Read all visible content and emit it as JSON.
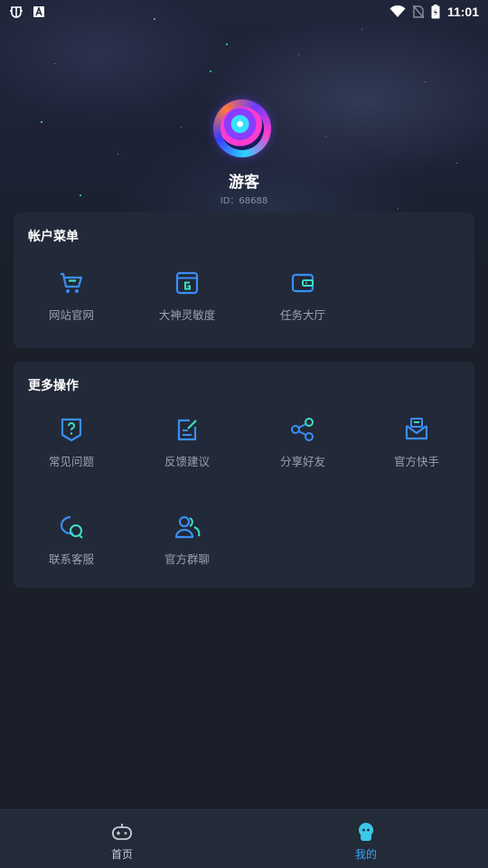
{
  "status_bar": {
    "time": "11:01"
  },
  "profile": {
    "name": "游客",
    "id_text": "ID：68688"
  },
  "account_menu": {
    "title": "帐户菜单",
    "items": [
      {
        "label": "网站官网",
        "icon": "cart-icon"
      },
      {
        "label": "大神灵敏度",
        "icon": "g-panel-icon"
      },
      {
        "label": "任务大厅",
        "icon": "wallet-icon"
      }
    ]
  },
  "more_actions": {
    "title": "更多操作",
    "items": [
      {
        "label": "常见问题",
        "icon": "question-shield-icon"
      },
      {
        "label": "反馈建议",
        "icon": "edit-note-icon"
      },
      {
        "label": "分享好友",
        "icon": "share-icon"
      },
      {
        "label": "官方快手",
        "icon": "mail-box-icon"
      },
      {
        "label": "联系客服",
        "icon": "chat-bubbles-icon"
      },
      {
        "label": "官方群聊",
        "icon": "group-users-icon"
      }
    ]
  },
  "tabbar": {
    "items": [
      {
        "label": "首页",
        "icon": "gamepad-icon",
        "active": false
      },
      {
        "label": "我的",
        "icon": "mascot-icon",
        "active": true
      }
    ]
  },
  "colors": {
    "background": "#1a1f2a",
    "card": "#222938",
    "icon_blue": "#3a8ef5",
    "label_gray": "#9aa0ae",
    "tab_active": "#3aa7f5"
  }
}
